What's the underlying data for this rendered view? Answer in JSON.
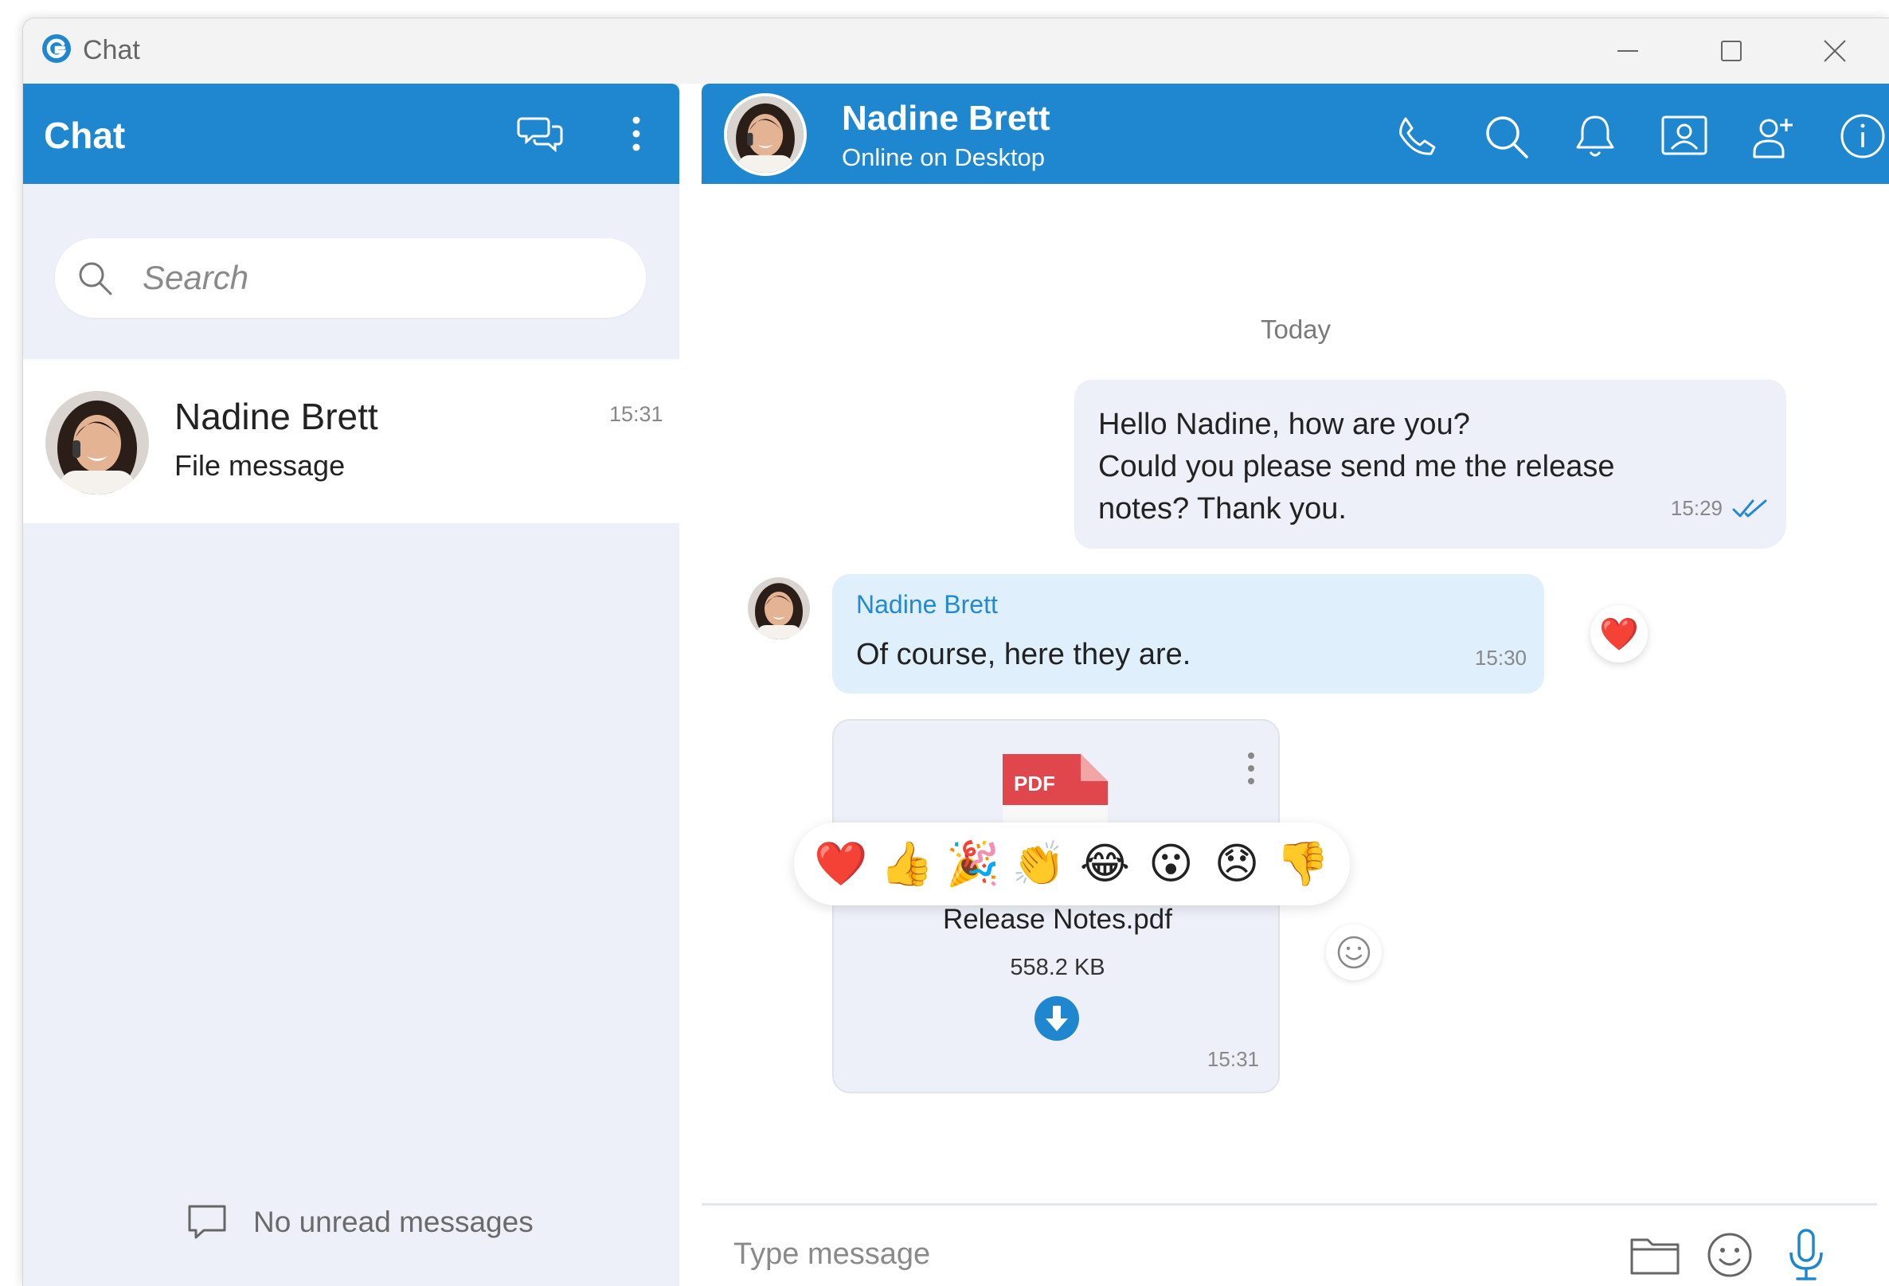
{
  "window": {
    "title": "Chat",
    "accent_color": "#1f87cf"
  },
  "left_panel": {
    "title": "Chat",
    "search_placeholder": "Search",
    "conversations": [
      {
        "name": "Nadine Brett",
        "preview": "File message",
        "time": "15:31"
      }
    ],
    "empty_status": "No unread messages"
  },
  "chat": {
    "contact_name": "Nadine Brett",
    "contact_status": "Online on Desktop",
    "date_separator": "Today",
    "messages": [
      {
        "direction": "outgoing",
        "lines": [
          "Hello Nadine, how are you?",
          "Could you please send me the release",
          "notes? Thank you."
        ],
        "time": "15:29",
        "status": "read"
      },
      {
        "direction": "incoming",
        "sender": "Nadine Brett",
        "text": "Of course, here they are.",
        "time": "15:30",
        "reaction": "❤️"
      },
      {
        "direction": "incoming",
        "type": "file",
        "file_type_label": "PDF",
        "file_name": "Release Notes.pdf",
        "file_size": "558.2 KB",
        "time": "15:31"
      }
    ],
    "reaction_options": [
      "❤️",
      "👍",
      "🎉",
      "👏",
      "😂",
      "😮",
      "😞",
      "👎"
    ],
    "composer_placeholder": "Type message"
  },
  "icons": {
    "header": [
      "phone-icon",
      "search-icon",
      "bell-icon",
      "contact-card-icon",
      "add-user-icon",
      "info-icon"
    ],
    "composer": [
      "folder-icon",
      "emoji-icon",
      "microphone-icon"
    ]
  }
}
